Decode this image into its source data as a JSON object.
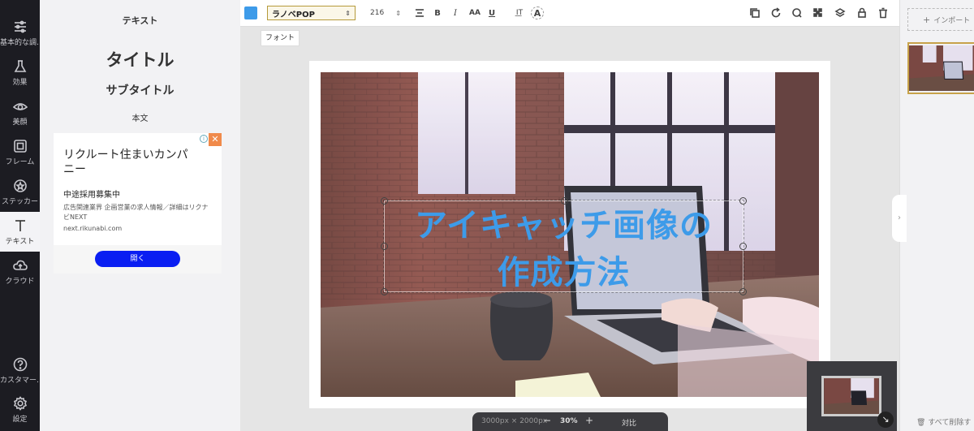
{
  "rail": {
    "items": [
      {
        "label": "基本的な調…",
        "icon": "sliders-icon"
      },
      {
        "label": "効果",
        "icon": "flask-icon"
      },
      {
        "label": "美顔",
        "icon": "eye-icon"
      },
      {
        "label": "フレーム",
        "icon": "frame-icon"
      },
      {
        "label": "ステッカー",
        "icon": "sticker-icon"
      },
      {
        "label": "テキスト",
        "icon": "text-icon"
      },
      {
        "label": "クラウド",
        "icon": "cloud-icon"
      },
      {
        "label": "カスタマー…",
        "icon": "help-icon"
      },
      {
        "label": "設定",
        "icon": "gear-icon"
      }
    ],
    "active": "テキスト"
  },
  "panel": {
    "heading": "テキスト",
    "title_preset": "タイトル",
    "subtitle_preset": "サブタイトル",
    "body_preset": "本文"
  },
  "ad": {
    "title": "リクルート住まいカンパニー",
    "heading": "中途採用募集中",
    "description": "広告関連業界 企画営業の求人情報／詳細はリクナビNEXT",
    "url": "next.rikunabi.com",
    "button": "開く",
    "close": "✕",
    "info": "i"
  },
  "toolbar": {
    "text_color": "#3d9be9",
    "font": "ラノベPOP",
    "font_size": "216",
    "tooltip": "フォント",
    "bold": "B",
    "italic": "I",
    "case": "AA",
    "underline": "U",
    "spacing": "I͟T",
    "effect": "A"
  },
  "canvas": {
    "headline_line1": "アイキャッチ画像の",
    "headline_line2": "作成方法"
  },
  "zoom": {
    "dimensions": "3000px × 2000px",
    "minus": "−",
    "level": "30%",
    "plus": "+",
    "compare": "対比"
  },
  "right_panel": {
    "import": "インポート",
    "delete_all": "すべて削除す"
  }
}
